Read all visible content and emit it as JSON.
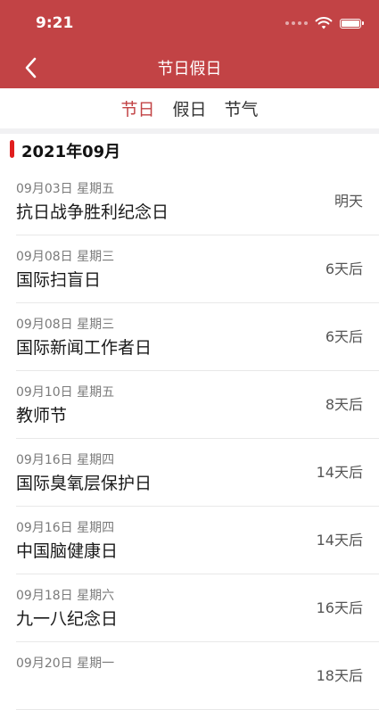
{
  "status": {
    "time": "9:21"
  },
  "header": {
    "title": "节日假日"
  },
  "tabs": [
    {
      "label": "节日",
      "active": true
    },
    {
      "label": "假日",
      "active": false
    },
    {
      "label": "节气",
      "active": false
    }
  ],
  "section": {
    "title": "2021年09月"
  },
  "items": [
    {
      "date": "09月03日 星期五",
      "name": "抗日战争胜利纪念日",
      "countdown": "明天"
    },
    {
      "date": "09月08日 星期三",
      "name": "国际扫盲日",
      "countdown": "6天后"
    },
    {
      "date": "09月08日 星期三",
      "name": "国际新闻工作者日",
      "countdown": "6天后"
    },
    {
      "date": "09月10日 星期五",
      "name": "教师节",
      "countdown": "8天后"
    },
    {
      "date": "09月16日 星期四",
      "name": "国际臭氧层保护日",
      "countdown": "14天后"
    },
    {
      "date": "09月16日 星期四",
      "name": "中国脑健康日",
      "countdown": "14天后"
    },
    {
      "date": "09月18日 星期六",
      "name": "九一八纪念日",
      "countdown": "16天后"
    },
    {
      "date": "09月20日 星期一",
      "name": "",
      "countdown": "18天后"
    }
  ],
  "colors": {
    "accent": "#c24345",
    "section_bar": "#e01e1e"
  }
}
